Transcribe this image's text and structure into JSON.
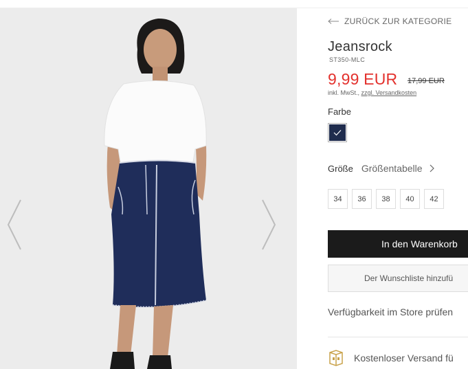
{
  "navigation": {
    "back_label": "ZURÜCK ZUR KATEGORIE"
  },
  "product": {
    "title": "Jeansrock",
    "sku": "ST350-MLC",
    "price": "9,99 EUR",
    "old_price": "17,99 EUR",
    "tax_prefix": "inkl. MwSt.,",
    "shipping_link": "zzgl. Versandkosten"
  },
  "color": {
    "label": "Farbe",
    "swatch_color": "#1f2c4d",
    "selected": true
  },
  "size": {
    "label": "Größe",
    "size_chart_label": "Größentabelle",
    "options": [
      "34",
      "36",
      "38",
      "40",
      "42"
    ]
  },
  "actions": {
    "add_to_cart": "In den Warenkorb",
    "wishlist": "Der Wunschliste hinzufü",
    "store_availability": "Verfügbarkeit im Store prüfen"
  },
  "shipping": {
    "free_shipping": "Kostenloser Versand fü"
  },
  "colors": {
    "accent_price": "#e3312d",
    "button_dark": "#1b1b1b"
  }
}
